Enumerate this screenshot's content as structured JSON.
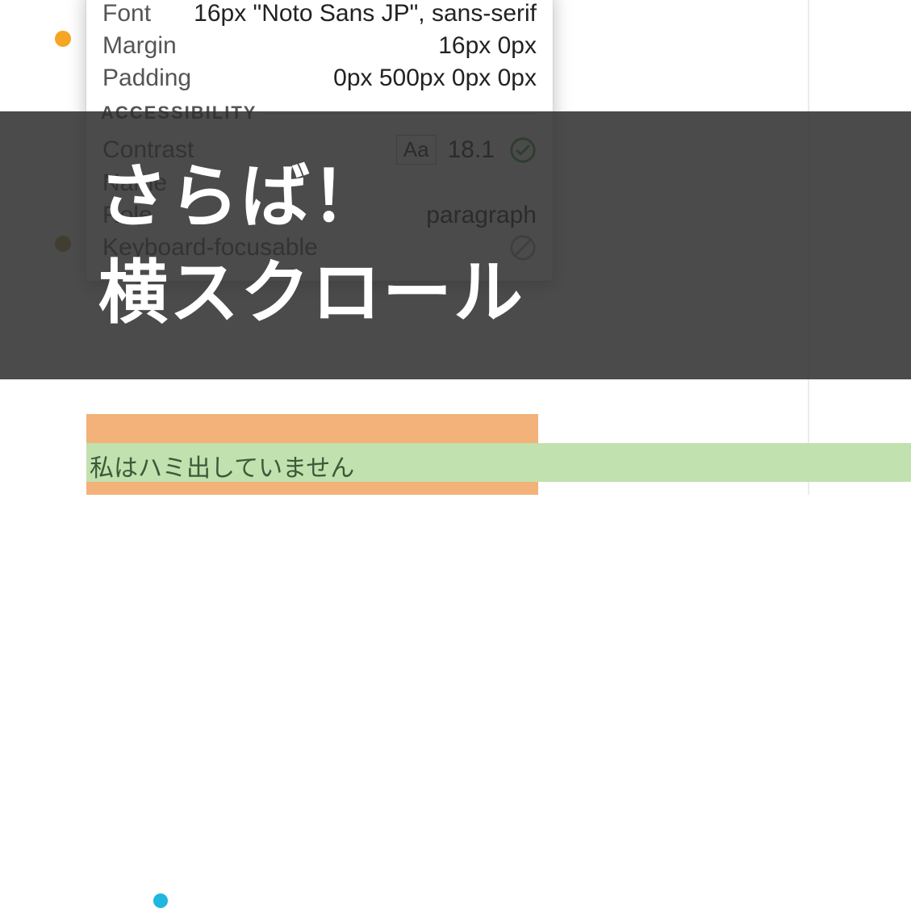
{
  "tooltip": {
    "style": {
      "font": {
        "label": "Font",
        "value": "16px \"Noto Sans JP\", sans-serif"
      },
      "margin": {
        "label": "Margin",
        "value": "16px 0px"
      },
      "padding": {
        "label": "Padding",
        "value": "0px 500px 0px 0px"
      }
    },
    "accessibility": {
      "heading": "ACCESSIBILITY",
      "contrast": {
        "label": "Contrast",
        "sample": "Aa",
        "value": "18.1"
      },
      "name": {
        "label": "Name",
        "value": ""
      },
      "role": {
        "label": "Role",
        "value": "paragraph"
      },
      "keyboard": {
        "label": "Keyboard-focusable"
      }
    }
  },
  "paragraph": {
    "text": "私はハミ出していません"
  },
  "banner": {
    "line1": "さらば！",
    "line2": "横スクロール"
  }
}
